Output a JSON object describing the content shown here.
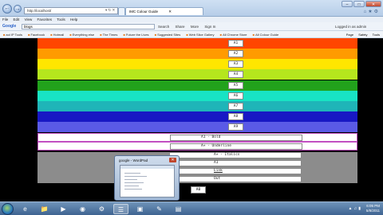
{
  "browser": {
    "address_url": "http://localhost/",
    "tabs": [
      {
        "label": ""
      },
      {
        "label": "IMC Colour Guide"
      }
    ],
    "window_buttons": {
      "minimize": "–",
      "maximize": "□",
      "close": "✕"
    },
    "menu": [
      "File",
      "Edit",
      "View",
      "Favorites",
      "Tools",
      "Help"
    ],
    "search": {
      "brand": "Google",
      "value": "blogs",
      "extras": [
        "Search",
        "Share",
        "More",
        "Sign In"
      ]
    },
    "login_text": "Logged in as admin",
    "favorites": [
      "aol IP Tools",
      "Facebook",
      "Hotmail",
      "Everything else",
      "The Times",
      "Future the Lives",
      "Suggested Sites",
      "Web Slice Gallery",
      "All Chrome Store",
      "All Colour Guide"
    ],
    "command_bar": [
      "Page",
      "Safety",
      "Tools"
    ]
  },
  "page": {
    "bands": [
      {
        "label": "A1",
        "color": "#ff4500"
      },
      {
        "label": "A2",
        "color": "#ff9b00"
      },
      {
        "label": "A3",
        "color": "#ffe600"
      },
      {
        "label": "A4",
        "color": "#b5e61d"
      },
      {
        "label": "A5",
        "color": "#22a21c"
      },
      {
        "label": "A6",
        "color": "#18e3c4"
      },
      {
        "label": "A7",
        "color": "#1fb5b8"
      },
      {
        "label": "A8",
        "color": "#1818c4"
      },
      {
        "label": "A9",
        "color": "#5a5ae6"
      }
    ],
    "style_rows": [
      {
        "label": "A1 - Bold"
      },
      {
        "label": "A+ - Underline"
      },
      {
        "label": "A+ - Italics"
      }
    ],
    "gray_rows": [
      "A1",
      "Link",
      "Out"
    ],
    "bottom_label": "A0"
  },
  "thumbnail": {
    "title": "google - WordPad",
    "close": "✕"
  },
  "taskbar": {
    "items": [
      {
        "name": "ie",
        "glyph": "e"
      },
      {
        "name": "folder",
        "glyph": "📁"
      },
      {
        "name": "media",
        "glyph": "▶"
      },
      {
        "name": "chrome",
        "glyph": "◉"
      },
      {
        "name": "steam",
        "glyph": "⚙"
      },
      {
        "name": "app1",
        "glyph": "☰"
      },
      {
        "name": "app2",
        "glyph": "▣"
      },
      {
        "name": "app3",
        "glyph": "✎"
      },
      {
        "name": "app4",
        "glyph": "▤"
      }
    ],
    "time": "6:05 PM",
    "date": "5/8/2011"
  }
}
